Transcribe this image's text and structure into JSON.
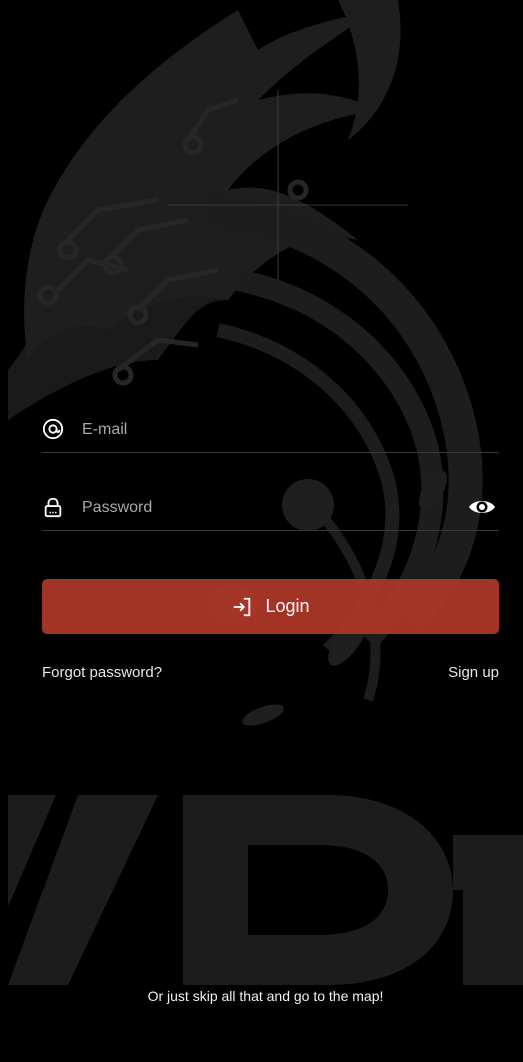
{
  "login_form": {
    "email": {
      "placeholder": "E-mail",
      "value": "",
      "icon": "at-icon"
    },
    "password": {
      "placeholder": "Password",
      "value": "",
      "icon": "lock-icon",
      "toggle_icon": "eye-icon"
    },
    "login_button": {
      "label": "Login",
      "icon": "login-icon",
      "color": "#b03828"
    },
    "forgot_password_label": "Forgot password?",
    "sign_up_label": "Sign up"
  },
  "skip_label": "Or just skip all that and go to the map!",
  "background": {
    "logo_icon": "dragon-logo",
    "logo_color": "#1f1f1f",
    "page_color": "#000000"
  }
}
